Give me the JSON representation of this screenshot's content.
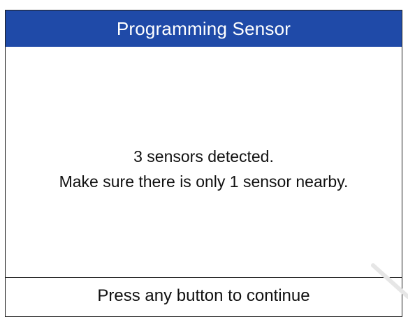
{
  "header": {
    "title": "Programming Sensor"
  },
  "message": {
    "line1": "3 sensors detected.",
    "line2": "Make sure there is only 1 sensor nearby."
  },
  "footer": {
    "prompt": "Press any button to continue"
  },
  "colors": {
    "header_bg": "#1f4aa8",
    "header_text": "#ffffff",
    "body_text": "#111111"
  }
}
